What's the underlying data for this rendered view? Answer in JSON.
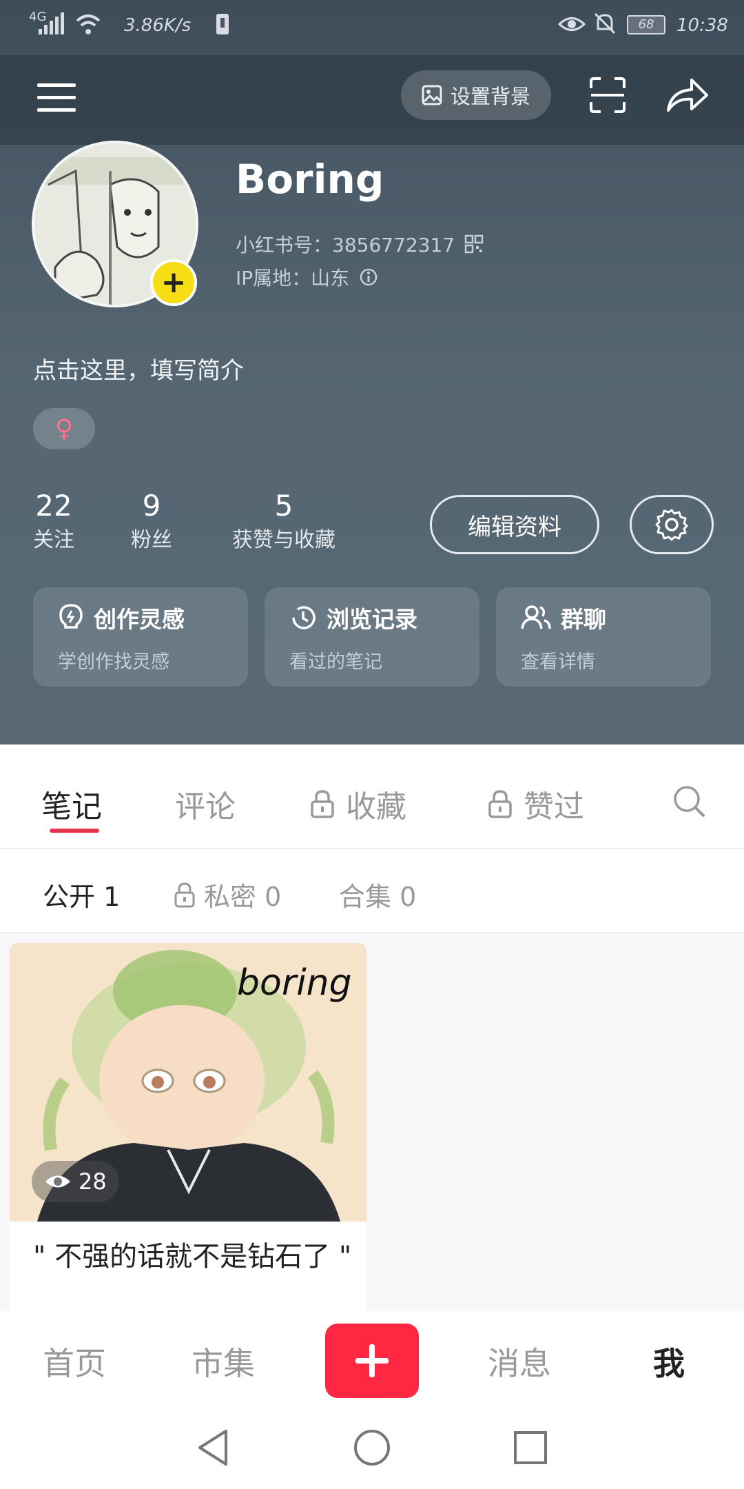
{
  "status_bar": {
    "network": "4G",
    "speed": "3.86K/s",
    "battery": "68",
    "time": "10:38"
  },
  "top_bar": {
    "set_background_label": "设置背景"
  },
  "profile": {
    "name": "Boring",
    "id_label": "小红书号：3856772317",
    "ip_label": "IP属地：山东",
    "bio_prompt": "点击这里，填写简介",
    "gender_symbol": "♀"
  },
  "stats": [
    {
      "value": "22",
      "label": "关注"
    },
    {
      "value": "9",
      "label": "粉丝"
    },
    {
      "value": "5",
      "label": "获赞与收藏"
    }
  ],
  "edit_profile_label": "编辑资料",
  "cards": [
    {
      "title": "创作灵感",
      "sub": "学创作找灵感",
      "icon": "lightbulb-icon"
    },
    {
      "title": "浏览记录",
      "sub": "看过的笔记",
      "icon": "clock-icon"
    },
    {
      "title": "群聊",
      "sub": "查看详情",
      "icon": "group-icon"
    }
  ],
  "tabs": [
    {
      "label": "笔记",
      "locked": false,
      "active": true
    },
    {
      "label": "评论",
      "locked": false,
      "active": false
    },
    {
      "label": "收藏",
      "locked": true,
      "active": false
    },
    {
      "label": "赞过",
      "locked": true,
      "active": false
    }
  ],
  "subtabs": [
    {
      "label": "公开 1",
      "locked": false,
      "active": true
    },
    {
      "label": "私密 0",
      "locked": true,
      "active": false
    },
    {
      "label": "合集 0",
      "locked": false,
      "active": false
    }
  ],
  "note": {
    "image_text": "boring",
    "views": "28",
    "title": "\" 不强的话就不是钻石了 \""
  },
  "bottom_nav": {
    "home": "首页",
    "market": "市集",
    "messages": "消息",
    "me": "我"
  },
  "colors": {
    "accent": "#ff2741",
    "tab_indicator": "#e8344a"
  }
}
